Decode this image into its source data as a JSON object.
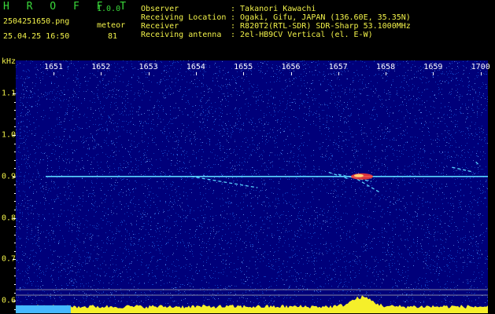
{
  "app": {
    "title": "H R O F F T",
    "version": "1.0.0",
    "filename": "2504251650.png",
    "datetime": "25.04.25 16:50",
    "meteor_label": "meteor",
    "meteor_count": "81"
  },
  "station": {
    "rows": [
      {
        "label": "Observer",
        "value": ": Takanori Kawachi"
      },
      {
        "label": "Receiving Location",
        "value": ": Ogaki, Gifu, JAPAN (136.60E, 35.35N)"
      },
      {
        "label": "Receiver",
        "value": ": R820T2(RTL-SDR) SDR-Sharp 53.1000MHz"
      },
      {
        "label": "Receiving antenna",
        "value": ": 2el-HB9CV Vertical (el. E-W)"
      }
    ]
  },
  "axes": {
    "y_unit": "kHz",
    "x_ticks": [
      "1651",
      "1652",
      "1653",
      "1654",
      "1655",
      "1656",
      "1657",
      "1658",
      "1659",
      "1700"
    ],
    "y_ticks": [
      "1.1",
      "1.0",
      "0.9",
      "0.8",
      "0.7",
      "0.6"
    ]
  },
  "colors": {
    "background": "#00007a",
    "noise": "#1e6cf0",
    "carrier": "#59d6ff",
    "echo_hot": "#ff3b30",
    "baseline": "#f5ef2a",
    "label_yellow": "#f2f24a",
    "label_green": "#3ad83a"
  },
  "chart_data": {
    "type": "heatmap",
    "x_ticks": [
      "1651",
      "1652",
      "1653",
      "1654",
      "1655",
      "1656",
      "1657",
      "1658",
      "1659",
      "1700"
    ],
    "y_ticks": [
      1.1,
      1.0,
      0.9,
      0.8,
      0.7,
      0.6
    ],
    "ylabel": "kHz",
    "ylim": [
      0.57,
      1.18
    ],
    "carrier_khz": 0.9,
    "echoes": [
      {
        "start_time": "1653.9",
        "end_time": "1655.3",
        "f_start": 0.9,
        "f_end": 0.873
      },
      {
        "start_time": "1656.8",
        "end_time": "1657.2",
        "f_start": 0.91,
        "f_end": 0.895
      },
      {
        "start_time": "1657.0",
        "end_time": "1657.7",
        "f_start": 0.905,
        "f_end": 0.888
      },
      {
        "start_time": "1657.3",
        "end_time": "1657.9",
        "f_start": 0.9,
        "f_end": 0.86
      },
      {
        "start_time": "1659.4",
        "end_time": "1659.8",
        "f_start": 0.922,
        "f_end": 0.912
      },
      {
        "start_time": "1659.9",
        "end_time": "1659.99",
        "f_start": 0.935,
        "f_end": 0.925
      }
    ]
  }
}
